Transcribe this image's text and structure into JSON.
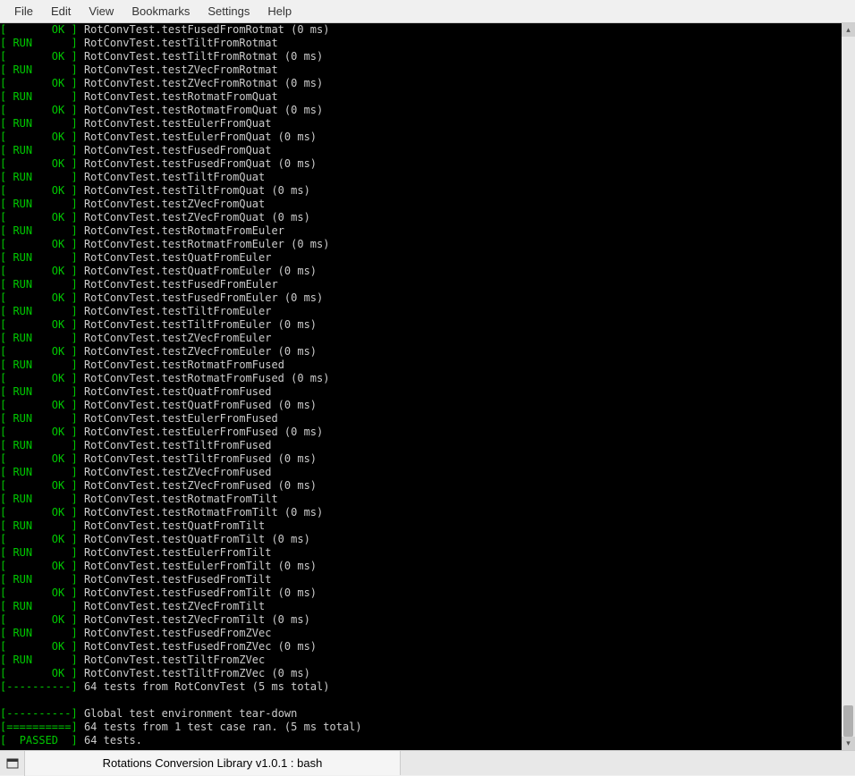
{
  "menu": {
    "file": "File",
    "edit": "Edit",
    "view": "View",
    "bookmarks": "Bookmarks",
    "settings": "Settings",
    "help": "Help"
  },
  "tab_title": "Rotations Conversion Library v1.0.1 : bash",
  "lines": [
    {
      "status": "OK",
      "text": "RotConvTest.testFusedFromRotmat (0 ms)"
    },
    {
      "status": "RUN",
      "text": "RotConvTest.testTiltFromRotmat"
    },
    {
      "status": "OK",
      "text": "RotConvTest.testTiltFromRotmat (0 ms)"
    },
    {
      "status": "RUN",
      "text": "RotConvTest.testZVecFromRotmat"
    },
    {
      "status": "OK",
      "text": "RotConvTest.testZVecFromRotmat (0 ms)"
    },
    {
      "status": "RUN",
      "text": "RotConvTest.testRotmatFromQuat"
    },
    {
      "status": "OK",
      "text": "RotConvTest.testRotmatFromQuat (0 ms)"
    },
    {
      "status": "RUN",
      "text": "RotConvTest.testEulerFromQuat"
    },
    {
      "status": "OK",
      "text": "RotConvTest.testEulerFromQuat (0 ms)"
    },
    {
      "status": "RUN",
      "text": "RotConvTest.testFusedFromQuat"
    },
    {
      "status": "OK",
      "text": "RotConvTest.testFusedFromQuat (0 ms)"
    },
    {
      "status": "RUN",
      "text": "RotConvTest.testTiltFromQuat"
    },
    {
      "status": "OK",
      "text": "RotConvTest.testTiltFromQuat (0 ms)"
    },
    {
      "status": "RUN",
      "text": "RotConvTest.testZVecFromQuat"
    },
    {
      "status": "OK",
      "text": "RotConvTest.testZVecFromQuat (0 ms)"
    },
    {
      "status": "RUN",
      "text": "RotConvTest.testRotmatFromEuler"
    },
    {
      "status": "OK",
      "text": "RotConvTest.testRotmatFromEuler (0 ms)"
    },
    {
      "status": "RUN",
      "text": "RotConvTest.testQuatFromEuler"
    },
    {
      "status": "OK",
      "text": "RotConvTest.testQuatFromEuler (0 ms)"
    },
    {
      "status": "RUN",
      "text": "RotConvTest.testFusedFromEuler"
    },
    {
      "status": "OK",
      "text": "RotConvTest.testFusedFromEuler (0 ms)"
    },
    {
      "status": "RUN",
      "text": "RotConvTest.testTiltFromEuler"
    },
    {
      "status": "OK",
      "text": "RotConvTest.testTiltFromEuler (0 ms)"
    },
    {
      "status": "RUN",
      "text": "RotConvTest.testZVecFromEuler"
    },
    {
      "status": "OK",
      "text": "RotConvTest.testZVecFromEuler (0 ms)"
    },
    {
      "status": "RUN",
      "text": "RotConvTest.testRotmatFromFused"
    },
    {
      "status": "OK",
      "text": "RotConvTest.testRotmatFromFused (0 ms)"
    },
    {
      "status": "RUN",
      "text": "RotConvTest.testQuatFromFused"
    },
    {
      "status": "OK",
      "text": "RotConvTest.testQuatFromFused (0 ms)"
    },
    {
      "status": "RUN",
      "text": "RotConvTest.testEulerFromFused"
    },
    {
      "status": "OK",
      "text": "RotConvTest.testEulerFromFused (0 ms)"
    },
    {
      "status": "RUN",
      "text": "RotConvTest.testTiltFromFused"
    },
    {
      "status": "OK",
      "text": "RotConvTest.testTiltFromFused (0 ms)"
    },
    {
      "status": "RUN",
      "text": "RotConvTest.testZVecFromFused"
    },
    {
      "status": "OK",
      "text": "RotConvTest.testZVecFromFused (0 ms)"
    },
    {
      "status": "RUN",
      "text": "RotConvTest.testRotmatFromTilt"
    },
    {
      "status": "OK",
      "text": "RotConvTest.testRotmatFromTilt (0 ms)"
    },
    {
      "status": "RUN",
      "text": "RotConvTest.testQuatFromTilt"
    },
    {
      "status": "OK",
      "text": "RotConvTest.testQuatFromTilt (0 ms)"
    },
    {
      "status": "RUN",
      "text": "RotConvTest.testEulerFromTilt"
    },
    {
      "status": "OK",
      "text": "RotConvTest.testEulerFromTilt (0 ms)"
    },
    {
      "status": "RUN",
      "text": "RotConvTest.testFusedFromTilt"
    },
    {
      "status": "OK",
      "text": "RotConvTest.testFusedFromTilt (0 ms)"
    },
    {
      "status": "RUN",
      "text": "RotConvTest.testZVecFromTilt"
    },
    {
      "status": "OK",
      "text": "RotConvTest.testZVecFromTilt (0 ms)"
    },
    {
      "status": "RUN",
      "text": "RotConvTest.testFusedFromZVec"
    },
    {
      "status": "OK",
      "text": "RotConvTest.testFusedFromZVec (0 ms)"
    },
    {
      "status": "RUN",
      "text": "RotConvTest.testTiltFromZVec"
    },
    {
      "status": "OK",
      "text": "RotConvTest.testTiltFromZVec (0 ms)"
    },
    {
      "status": "DASH",
      "text": "64 tests from RotConvTest (5 ms total)"
    },
    {
      "status": "BLANK",
      "text": ""
    },
    {
      "status": "DASH",
      "text": "Global test environment tear-down"
    },
    {
      "status": "EQ",
      "text": "64 tests from 1 test case ran. (5 ms total)"
    },
    {
      "status": "PASSED",
      "text": "64 tests."
    }
  ]
}
